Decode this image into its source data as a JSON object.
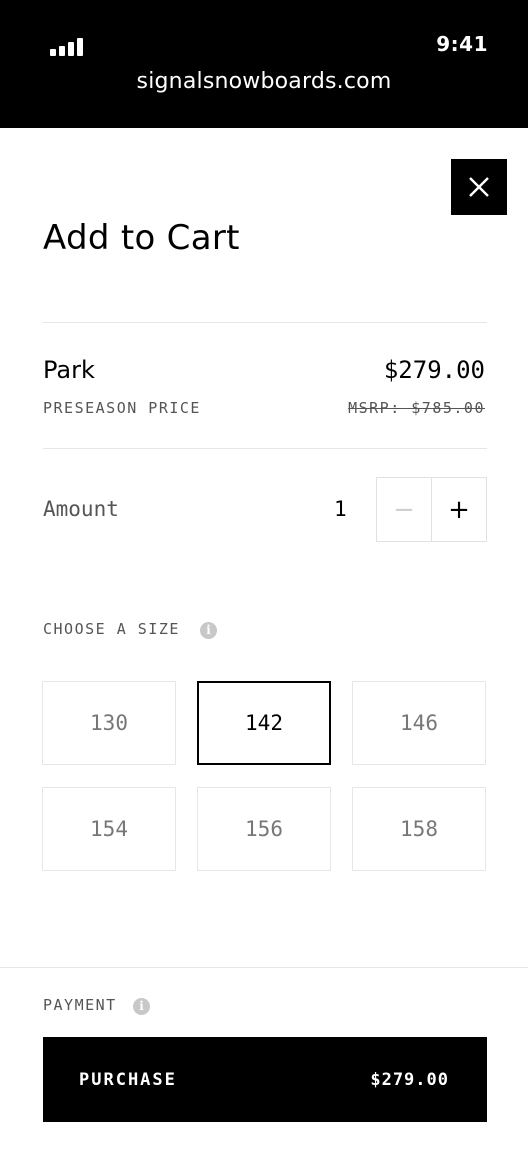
{
  "browser": {
    "time": "9:41",
    "url": "signalsnowboards.com"
  },
  "modal": {
    "title": "Add to Cart",
    "close_icon": "close-icon"
  },
  "product": {
    "name": "Park",
    "price": "$279.00",
    "price_note": "PRESEASON PRICE",
    "msrp": "MSRP: $785.00"
  },
  "amount": {
    "label": "Amount",
    "value": "1",
    "decrement": "−",
    "increment": "+"
  },
  "size": {
    "label": "CHOOSE A SIZE",
    "info_icon": "info-icon",
    "options": [
      "130",
      "142",
      "146",
      "154",
      "156",
      "158"
    ],
    "selected": "142"
  },
  "payment": {
    "label": "PAYMENT",
    "info_icon": "info-icon",
    "button_label": "PURCHASE",
    "button_amount": "$279.00"
  },
  "colors": {
    "primary": "#000000",
    "muted_text": "#555555",
    "border": "#e6e6e6"
  }
}
